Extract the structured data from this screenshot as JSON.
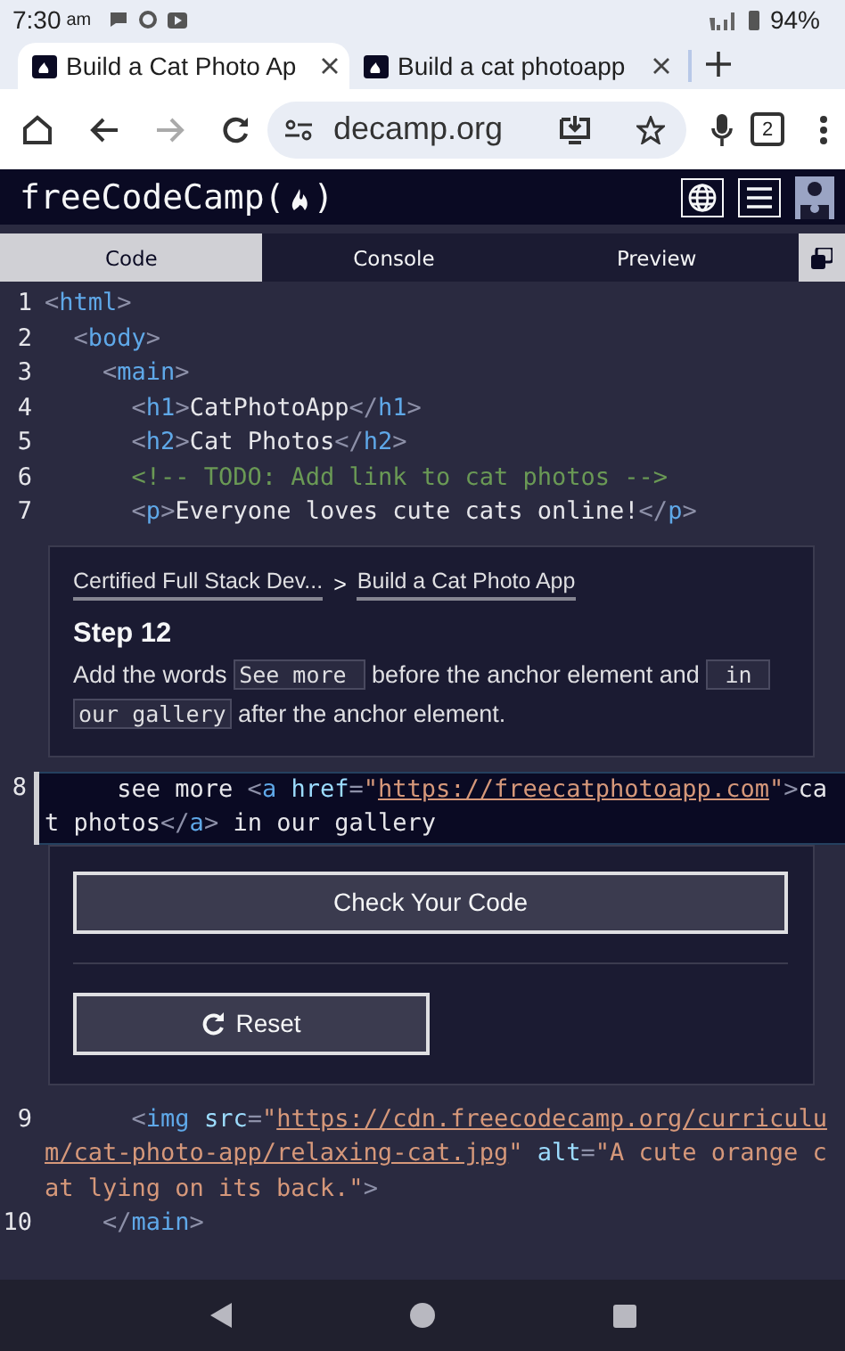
{
  "status_bar": {
    "time": "7:30",
    "period": "am",
    "battery": "94%"
  },
  "browser_tabs": [
    {
      "title": "Build a Cat Photo Ap",
      "selected": true
    },
    {
      "title": "Build a cat photoapp",
      "selected": false
    }
  ],
  "toolbar": {
    "url": "decamp.org",
    "tab_count": "2"
  },
  "site_nav": {
    "logo_start": "freeCodeCamp(",
    "logo_end": ")"
  },
  "editor_tabs": [
    {
      "label": "Code",
      "selected": true
    },
    {
      "label": "Console",
      "selected": false
    },
    {
      "label": "Preview",
      "selected": false
    }
  ],
  "editor": {
    "blocks": [
      {
        "kind": "code",
        "lines": [
          {
            "number": "1",
            "active": false,
            "tokens": [
              {
                "kind": "punct",
                "text": "<"
              },
              {
                "kind": "tag",
                "text": "html"
              },
              {
                "kind": "punct",
                "text": ">"
              }
            ]
          },
          {
            "number": "2",
            "active": false,
            "tokens": [
              {
                "kind": "punct",
                "text": "  <"
              },
              {
                "kind": "tag",
                "text": "body"
              },
              {
                "kind": "punct",
                "text": ">"
              }
            ]
          },
          {
            "number": "3",
            "active": false,
            "tokens": [
              {
                "kind": "punct",
                "text": "    <"
              },
              {
                "kind": "tag",
                "text": "main"
              },
              {
                "kind": "punct",
                "text": ">"
              }
            ]
          },
          {
            "number": "4",
            "active": false,
            "tokens": [
              {
                "kind": "punct",
                "text": "      <"
              },
              {
                "kind": "tag",
                "text": "h1"
              },
              {
                "kind": "punct",
                "text": ">"
              },
              {
                "kind": "text",
                "text": "CatPhotoApp"
              },
              {
                "kind": "punct",
                "text": "</"
              },
              {
                "kind": "tag",
                "text": "h1"
              },
              {
                "kind": "punct",
                "text": ">"
              }
            ]
          },
          {
            "number": "5",
            "active": false,
            "tokens": [
              {
                "kind": "punct",
                "text": "      <"
              },
              {
                "kind": "tag",
                "text": "h2"
              },
              {
                "kind": "punct",
                "text": ">"
              },
              {
                "kind": "text",
                "text": "Cat Photos"
              },
              {
                "kind": "punct",
                "text": "</"
              },
              {
                "kind": "tag",
                "text": "h2"
              },
              {
                "kind": "punct",
                "text": ">"
              }
            ]
          },
          {
            "number": "6",
            "active": false,
            "tokens": [
              {
                "kind": "comment",
                "text": "      <!-- TODO: Add link to cat photos -->"
              }
            ]
          },
          {
            "number": "7",
            "active": false,
            "tokens": [
              {
                "kind": "punct",
                "text": "      <"
              },
              {
                "kind": "tag",
                "text": "p"
              },
              {
                "kind": "punct",
                "text": ">"
              },
              {
                "kind": "text",
                "text": "Everyone loves cute cats online!"
              },
              {
                "kind": "punct",
                "text": "</"
              },
              {
                "kind": "tag",
                "text": "p"
              },
              {
                "kind": "punct",
                "text": ">"
              }
            ]
          }
        ]
      },
      {
        "kind": "instructions",
        "breadcrumbs": [
          "Certified Full Stack Dev...",
          "Build a Cat Photo App"
        ],
        "separator": ">",
        "step": "Step 12",
        "description": [
          {
            "kind": "text",
            "text": "Add the words "
          },
          {
            "kind": "code",
            "text": "See more "
          },
          {
            "kind": "text",
            "text": " before the anchor element and "
          },
          {
            "kind": "code",
            "text": " in our gallery"
          },
          {
            "kind": "text",
            "text": " after the anchor element."
          }
        ]
      },
      {
        "kind": "code",
        "lines": [
          {
            "number": "8",
            "active": true,
            "tokens": [
              {
                "kind": "text",
                "text": "     see more "
              },
              {
                "kind": "punct",
                "text": "<"
              },
              {
                "kind": "tag",
                "text": "a"
              },
              {
                "kind": "attr",
                "text": " href"
              },
              {
                "kind": "punct",
                "text": "="
              },
              {
                "kind": "string",
                "text": "\""
              },
              {
                "kind": "link",
                "text": "https://freecatphotoapp.com"
              },
              {
                "kind": "string",
                "text": "\""
              },
              {
                "kind": "punct",
                "text": ">"
              },
              {
                "kind": "text",
                "text": "cat photos"
              },
              {
                "kind": "punct",
                "text": "</"
              },
              {
                "kind": "tag",
                "text": "a"
              },
              {
                "kind": "punct",
                "text": ">"
              },
              {
                "kind": "text",
                "text": " in our gallery"
              }
            ]
          }
        ]
      },
      {
        "kind": "actions",
        "buttons": [
          {
            "label": "Check Your Code",
            "kind": "primary"
          },
          {
            "label": "Reset",
            "kind": "reset"
          }
        ]
      },
      {
        "kind": "code",
        "lines": [
          {
            "number": "9",
            "active": false,
            "tokens": [
              {
                "kind": "punct",
                "text": "      <"
              },
              {
                "kind": "tag",
                "text": "img"
              },
              {
                "kind": "attr",
                "text": " src"
              },
              {
                "kind": "punct",
                "text": "="
              },
              {
                "kind": "string",
                "text": "\""
              },
              {
                "kind": "link",
                "text": "https://cdn.freecodecamp.org/curriculum/cat-photo-app/relaxing-cat.jpg"
              },
              {
                "kind": "string",
                "text": "\""
              },
              {
                "kind": "attr",
                "text": " alt"
              },
              {
                "kind": "punct",
                "text": "="
              },
              {
                "kind": "string",
                "text": "\"A cute orange cat lying on its back.\""
              },
              {
                "kind": "punct",
                "text": ">"
              }
            ]
          },
          {
            "number": "10",
            "active": false,
            "tokens": [
              {
                "kind": "punct",
                "text": "    </"
              },
              {
                "kind": "tag",
                "text": "main"
              },
              {
                "kind": "punct",
                "text": ">"
              }
            ]
          }
        ]
      }
    ]
  }
}
